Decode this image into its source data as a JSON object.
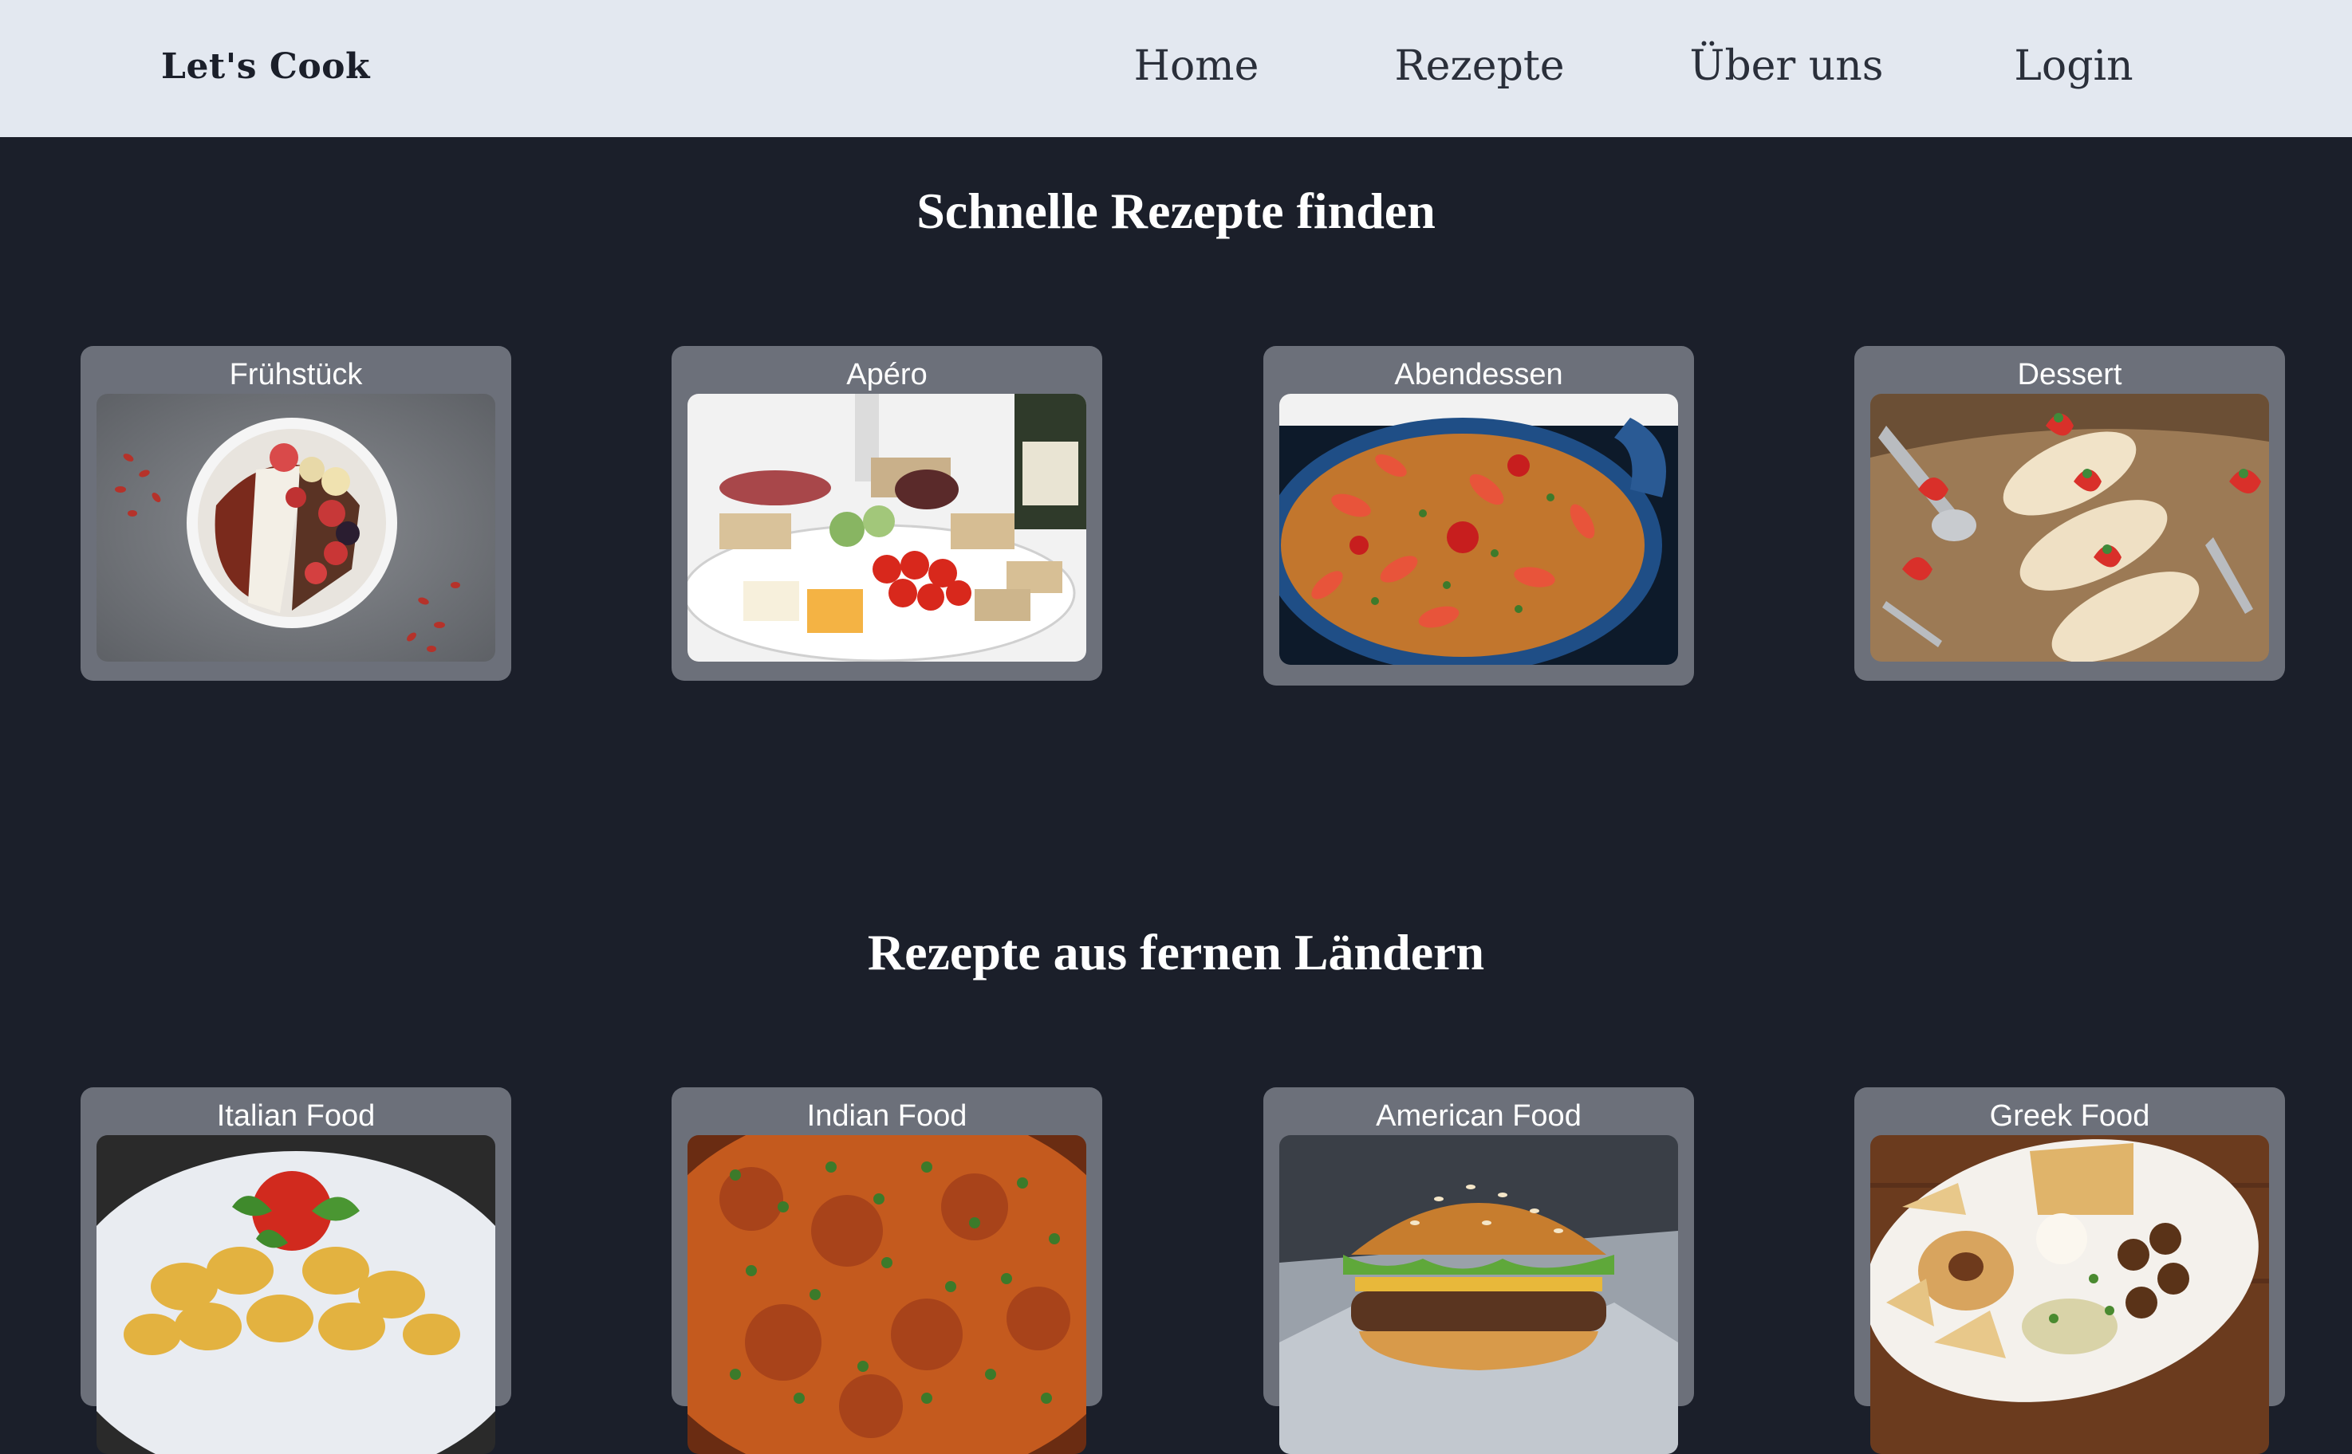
{
  "header": {
    "brand": "Let's Cook",
    "nav": {
      "home": "Home",
      "recipes": "Rezepte",
      "about": "Über uns",
      "login": "Login"
    }
  },
  "sections": [
    {
      "title": "Schnelle Rezepte finden",
      "cards": [
        {
          "label": "Frühstück",
          "image": "smoothie-bowl-photo"
        },
        {
          "label": "Apéro",
          "image": "aperitif-platter-photo"
        },
        {
          "label": "Abendessen",
          "image": "paella-photo"
        },
        {
          "label": "Dessert",
          "image": "strawberry-eclair-photo"
        }
      ]
    },
    {
      "title": "Rezepte aus fernen Ländern",
      "cards": [
        {
          "label": "Italian Food",
          "image": "tortellini-photo"
        },
        {
          "label": "Indian Food",
          "image": "curry-photo"
        },
        {
          "label": "American Food",
          "image": "burger-photo"
        },
        {
          "label": "Greek Food",
          "image": "greek-platter-photo"
        }
      ]
    }
  ],
  "colors": {
    "page_background": "#1b1f2a",
    "navbar_background": "#e3e8f0",
    "card_background": "#6c707a",
    "title_text": "#ffffff"
  }
}
